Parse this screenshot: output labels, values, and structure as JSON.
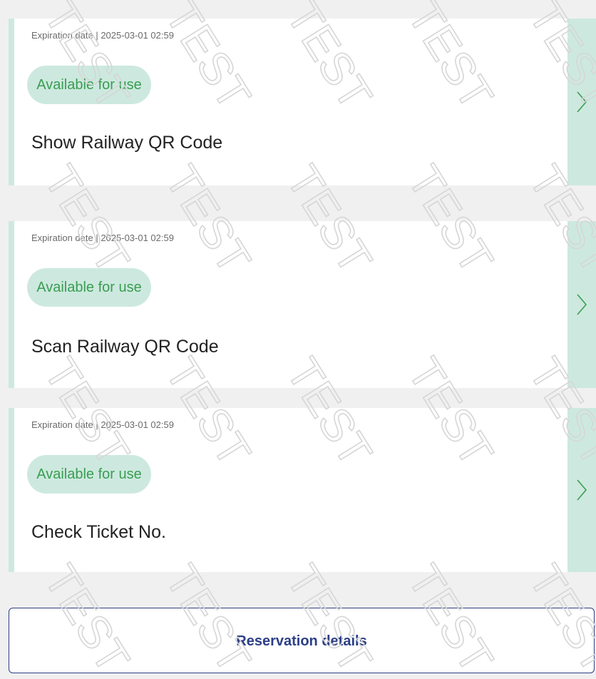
{
  "cards": [
    {
      "expiry": "Expiration date | 2025-03-01 02:59",
      "status": "Available for use",
      "title": "Show Railway QR Code"
    },
    {
      "expiry": "Expiration date | 2025-03-01 02:59",
      "status": "Available for use",
      "title": "Scan Railway QR Code"
    },
    {
      "expiry": "Expiration date | 2025-03-01 02:59",
      "status": "Available for use",
      "title": "Check Ticket No."
    }
  ],
  "reservation_button": {
    "label": "Reservation details"
  },
  "watermark": {
    "text": "TEST"
  },
  "colors": {
    "accent_green_bg": "#cde9df",
    "status_green_text": "#3a9d52",
    "button_navy": "#2c3f86"
  }
}
